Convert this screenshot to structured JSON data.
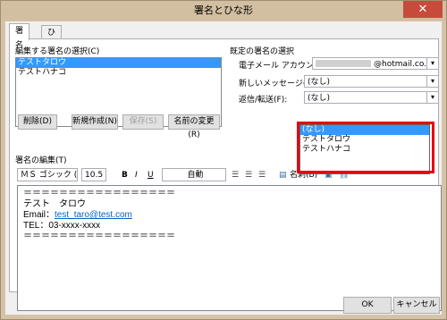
{
  "window": {
    "title": "署名とひな形",
    "close_glyph": "✕"
  },
  "tabs": [
    {
      "label": "署名",
      "active": true
    },
    {
      "label": "ひな形",
      "active": false
    }
  ],
  "signature_select": {
    "label": "編集する署名の選択(C)",
    "items": [
      "テストタロウ",
      "テストハナコ"
    ],
    "selected_index": 0
  },
  "buttons": {
    "delete": "削除(D)",
    "new": "新規作成(N)",
    "save": "保存(S)",
    "rename": "名前の変更(R)"
  },
  "default_signature": {
    "label": "既定の署名の選択",
    "email_label": "電子メール アカウント(A):",
    "email_value": "@hotmail.co.jp",
    "new_messages_label": "新しいメッセージ(M):",
    "new_messages_value": "(なし)",
    "replies_label": "返信/転送(F):",
    "replies_value": "(なし)"
  },
  "replies_dropdown": {
    "options": [
      "(なし)",
      "テストタロウ",
      "テストハナコ"
    ],
    "selected_index": 0
  },
  "editor_section": {
    "label": "署名の編集(T)",
    "font": "ＭＳ ゴシック (本文",
    "size": "10.5",
    "bold": "B",
    "italic": "I",
    "underline": "U",
    "color": "自動",
    "business_card": "名刺(B)",
    "lines": [
      "＝＝＝＝＝＝＝＝＝＝＝＝＝＝＝＝＝",
      "テスト　タロウ",
      "Email：",
      "TEL：03-xxxx-xxxx",
      "＝＝＝＝＝＝＝＝＝＝＝＝＝＝＝＝＝"
    ],
    "email_link": "test_taro@test.com"
  },
  "footer": {
    "ok": "OK",
    "cancel": "キャンセル"
  },
  "colors": {
    "highlight": "#e60012",
    "selection": "#3399ff",
    "close": "#c74b3b"
  },
  "icons": [
    "close-icon",
    "dropdown-arrow-icon",
    "align-left-icon",
    "align-center-icon",
    "align-right-icon",
    "business-card-icon",
    "picture-icon",
    "hyperlink-icon"
  ]
}
